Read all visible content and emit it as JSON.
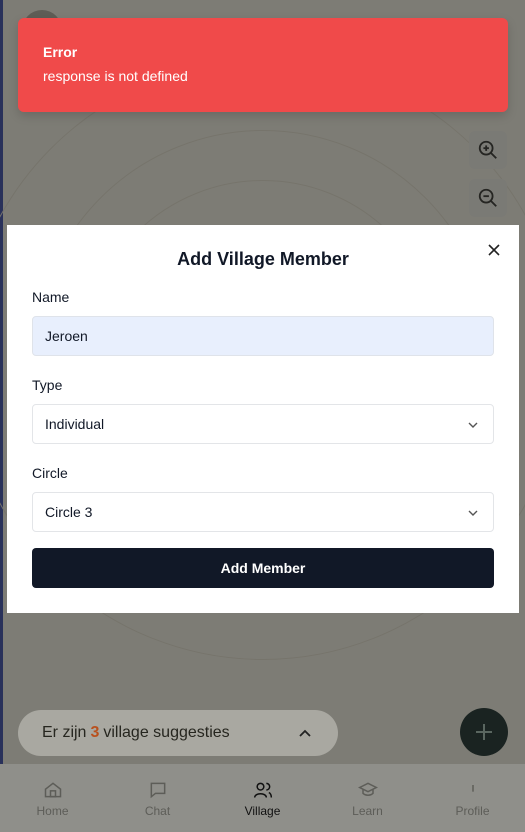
{
  "toast": {
    "title": "Error",
    "message": "response is not defined"
  },
  "modal": {
    "title": "Add Village Member",
    "fields": {
      "name": {
        "label": "Name",
        "value": "Jeroen"
      },
      "type": {
        "label": "Type",
        "value": "Individual"
      },
      "circle": {
        "label": "Circle",
        "value": "Circle 3"
      }
    },
    "submit_label": "Add Member"
  },
  "suggestions": {
    "prefix": "Er zijn",
    "count": "3",
    "suffix": "village suggesties"
  },
  "nav": {
    "items": [
      {
        "label": "Home",
        "icon": "home-icon"
      },
      {
        "label": "Chat",
        "icon": "chat-icon"
      },
      {
        "label": "Village",
        "icon": "users-icon"
      },
      {
        "label": "Learn",
        "icon": "graduation-cap-icon"
      },
      {
        "label": "Profile",
        "icon": "profile-icon"
      }
    ],
    "active": "Village"
  },
  "colors": {
    "error": "#f04a4a",
    "primary": "#111827",
    "input_filled": "#e8effd",
    "accent_count": "#b9501d"
  }
}
